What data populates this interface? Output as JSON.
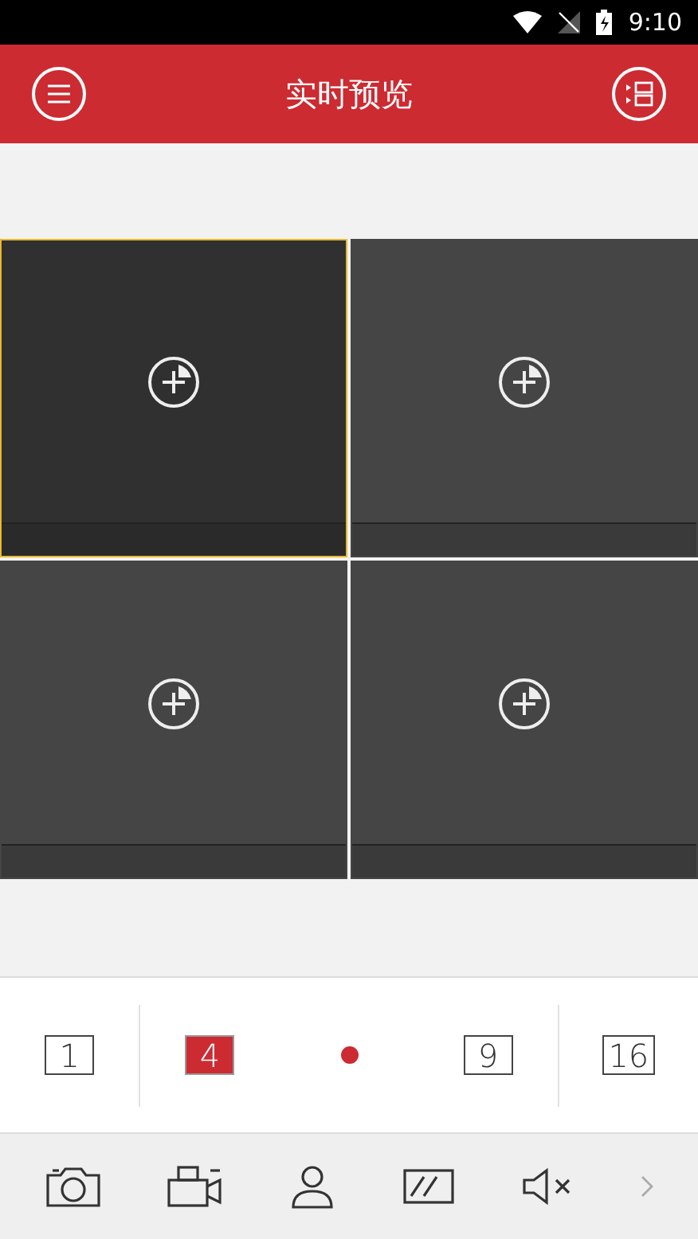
{
  "status_bar": {
    "time": "9:10"
  },
  "header": {
    "title": "实时预览"
  },
  "tiles": [
    {
      "selected": true
    },
    {
      "selected": false
    },
    {
      "selected": false
    },
    {
      "selected": false
    }
  ],
  "layout_bar": [
    {
      "kind": "layout",
      "label": "1",
      "selected": false
    },
    {
      "kind": "layout",
      "label": "4",
      "selected": true
    },
    {
      "kind": "dot"
    },
    {
      "kind": "layout",
      "label": "9",
      "selected": false
    },
    {
      "kind": "layout",
      "label": "16",
      "selected": false
    }
  ]
}
